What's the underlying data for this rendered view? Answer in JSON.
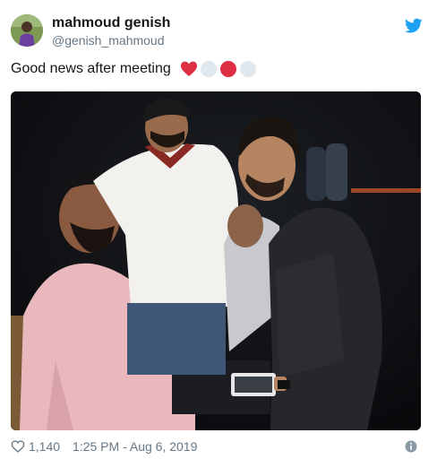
{
  "user": {
    "display_name": "mahmoud genish",
    "handle": "@genish_mahmoud"
  },
  "tweet": {
    "text": "Good news after meeting",
    "emojis": [
      "red-heart",
      "white-circle",
      "red-circle",
      "white-circle"
    ]
  },
  "footer": {
    "like_count": "1,140",
    "timestamp": "1:25 PM - Aug 6, 2019"
  },
  "colors": {
    "twitter_blue": "#1da1f2",
    "secondary_text": "#657786",
    "heart_red": "#e0245e"
  },
  "icons": [
    "twitter-bird-icon",
    "heart-outline-icon",
    "info-icon"
  ]
}
